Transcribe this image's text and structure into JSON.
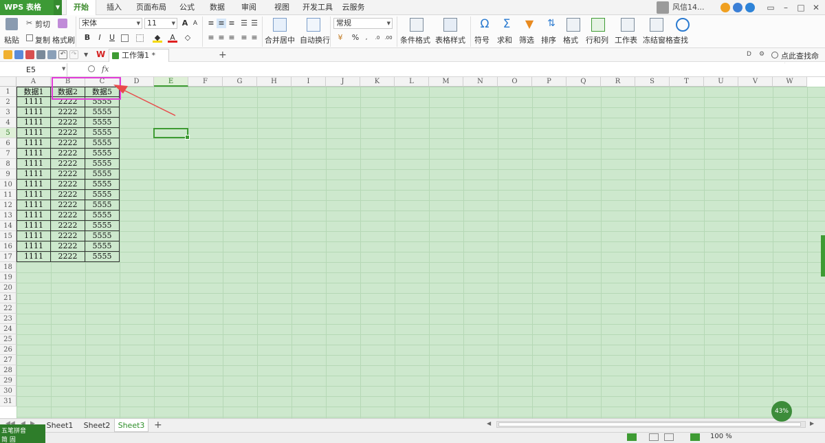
{
  "app": {
    "logo": "WPS 表格",
    "user": "风信14...",
    "zoom": "100 %"
  },
  "menu_tabs": [
    "开始",
    "插入",
    "页面布局",
    "公式",
    "数据",
    "审阅",
    "视图",
    "开发工具",
    "云服务"
  ],
  "ribbon": {
    "paste": "粘贴",
    "cut": "剪切",
    "copy": "复制",
    "format_painter": "格式刷",
    "font_name": "宋体",
    "font_size": "11",
    "bold": "B",
    "italic": "I",
    "underline": "U",
    "merge_center": "合并居中",
    "wrap": "自动换行",
    "number_format": "常规",
    "percent": "%",
    "cond_format": "条件格式",
    "table_style": "表格样式",
    "symbol": "符号",
    "sum": "求和",
    "filter": "筛选",
    "sort": "排序",
    "format": "格式",
    "row_col": "行和列",
    "worksheet": "工作表",
    "freeze": "冻结窗格",
    "find": "查找"
  },
  "quick": {
    "doc_tab": "工作簿1 *",
    "search_cmd": "点此查找命令"
  },
  "formula": {
    "name_box": "E5",
    "fx": "fx"
  },
  "grid": {
    "columns": [
      "A",
      "B",
      "C",
      "D",
      "E",
      "F",
      "G",
      "H",
      "I",
      "J",
      "K",
      "L",
      "M",
      "N",
      "O",
      "P",
      "Q",
      "R",
      "S",
      "T",
      "U",
      "V",
      "W"
    ],
    "selected_col": "E",
    "selected_row": 5,
    "row_count": 31,
    "headers": [
      "数据1",
      "数据2",
      "数据5"
    ],
    "row_values": [
      "1111",
      "2222",
      "5555"
    ],
    "data_rows": 16
  },
  "sheets": [
    "Sheet1",
    "Sheet2",
    "Sheet3"
  ],
  "active_sheet": "Sheet3",
  "ime": {
    "name": "五笔拼音",
    "mode": "简 固"
  },
  "colors": {
    "accent": "#3e9b33",
    "highlight": "#e23bd8",
    "arrow": "#e84b4b",
    "grid_bg": "#cde8cd"
  }
}
